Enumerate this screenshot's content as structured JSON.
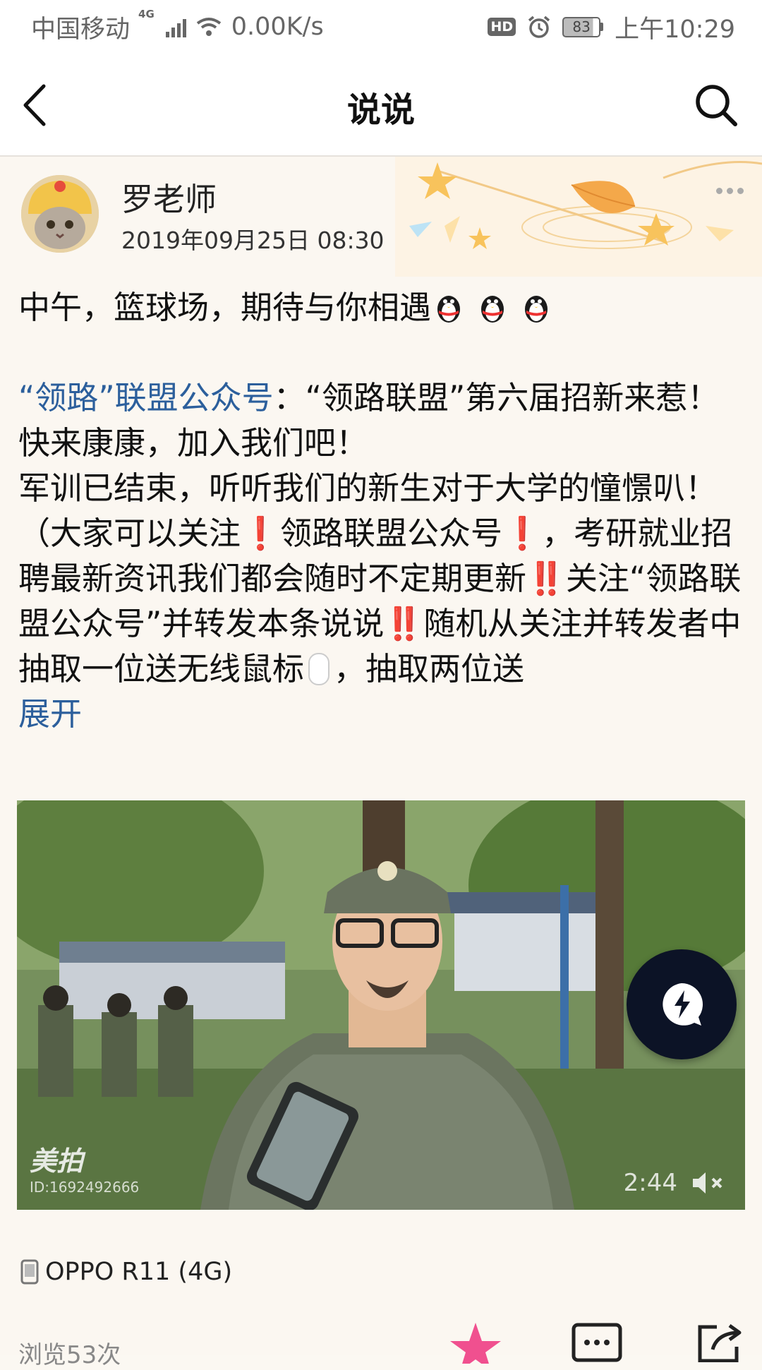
{
  "status_bar": {
    "carrier": "中国移动",
    "network": "4G",
    "speed": "0.00K/s",
    "hd": "HD",
    "battery": "83",
    "time": "上午10:29"
  },
  "header": {
    "title": "说说",
    "back_icon": "chevron-left-icon",
    "search_icon": "search-icon"
  },
  "post": {
    "author": "罗老师",
    "timestamp": "2019年09月25日 08:30",
    "line1_text": "中午，篮球场，期待与你相遇",
    "link_text": "“领路”联盟公众号",
    "para1": "：“领路联盟”第六届招新来惹！快来康康，加入我们吧！",
    "para2": "军训已结束，听听我们的新生对于大学的憧憬叭！",
    "para3_a": "（大家可以关注",
    "para3_b": "领路联盟公众号",
    "para3_c": "，考研就业招聘最新资讯我们都会随时不定期更新",
    "para3_d": "关注“领路联盟公众号”并转发本条说说",
    "para3_e": "随机从关注并转发者中抽取一位送无线鼠标",
    "para3_f": "，抽取两位送",
    "expand": "展开",
    "single_exclaim": "❗",
    "double_exclaim": "‼️"
  },
  "video": {
    "watermark": "美拍",
    "watermark_id": "ID:1692492666",
    "duration": "2:44"
  },
  "footer": {
    "device": "OPPO R11 (4G)",
    "views": "浏览53次"
  },
  "colors": {
    "link": "#2c5f9c",
    "accent_pink": "#f0508f",
    "float_button": "#0c1326"
  }
}
